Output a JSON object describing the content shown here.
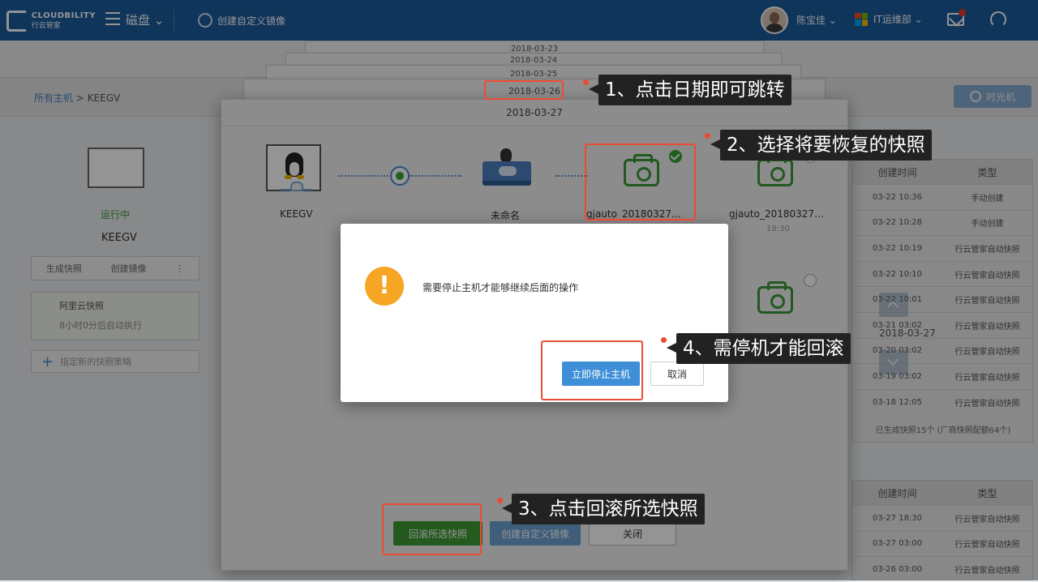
{
  "topbar": {
    "logo_title": "CLOUDBILITY",
    "logo_subtitle": "行云管家",
    "nav_disk": "磁盘 ⌄",
    "nav_create": "创建自定义镜像",
    "user": "陈宝佳 ⌄",
    "dept": "IT运维部 ⌄",
    "colors": {
      "bar": "#1a5c9e",
      "notify_dot": "#e6382d"
    }
  },
  "background": {
    "breadcrumb_link": "所有主机",
    "breadcrumb_sep": " > ",
    "breadcrumb_current": "KEEGV",
    "time_machine": "时光机",
    "host_status": "运行中",
    "host_name": "KEEGV",
    "action_snapshot": "生成快照",
    "action_image": "创建镜像",
    "policy_title": "阿里云快照",
    "policy_sub": "8小时0分后自动执行",
    "add_policy": "指定新的快照策略",
    "table1": {
      "headers": [
        "创建时间",
        "类型"
      ],
      "rows": [
        [
          "03-22 10:36",
          "手动创建"
        ],
        [
          "03-22 10:28",
          "手动创建"
        ],
        [
          "03-22 10:19",
          "行云管家自动快照"
        ],
        [
          "03-22 10:10",
          "行云管家自动快照"
        ],
        [
          "03-22 10:01",
          "行云管家自动快照"
        ],
        [
          "03-21 03:02",
          "行云管家自动快照"
        ],
        [
          "03-20 03:02",
          "行云管家自动快照"
        ],
        [
          "03-19 03:02",
          "行云管家自动快照"
        ],
        [
          "03-18 12:05",
          "行云管家自动快照"
        ]
      ],
      "footer": "已生成快照15个 (厂商快照配额64个)"
    },
    "table2": {
      "headers": [
        "创建时间",
        "类型"
      ],
      "rows": [
        [
          "03-27 18:30",
          "行云管家自动快照"
        ],
        [
          "03-27 03:00",
          "行云管家自动快照"
        ],
        [
          "03-26 03:00",
          "行云管家自动快照"
        ]
      ]
    }
  },
  "date_stack": [
    "2018-03-23",
    "2018-03-24",
    "2018-03-25",
    "2018-03-26"
  ],
  "modal": {
    "date": "2018-03-27",
    "host_name": "KEEGV",
    "snapshot0_label": "未命名",
    "snapshotA_label": "gjauto_20180327…",
    "snapshotB_label": "gjauto_20180327…",
    "snapshotB_time": "18:30",
    "btn_rollback": "回滚所选快照",
    "btn_custom_image": "创建自定义镜像",
    "btn_close": "关闭",
    "side_date": "2018-03-27"
  },
  "dialog": {
    "message": "需要停止主机才能够继续后面的操作",
    "btn_stop": "立即停止主机",
    "btn_cancel": "取消",
    "warn_icon": "!"
  },
  "annotations": {
    "step1": "1、点击日期即可跳转",
    "step2": "2、选择将要恢复的快照",
    "step3": "3、点击回滚所选快照",
    "step4": "4、需停机才能回滚",
    "color": "#ec4b33"
  }
}
